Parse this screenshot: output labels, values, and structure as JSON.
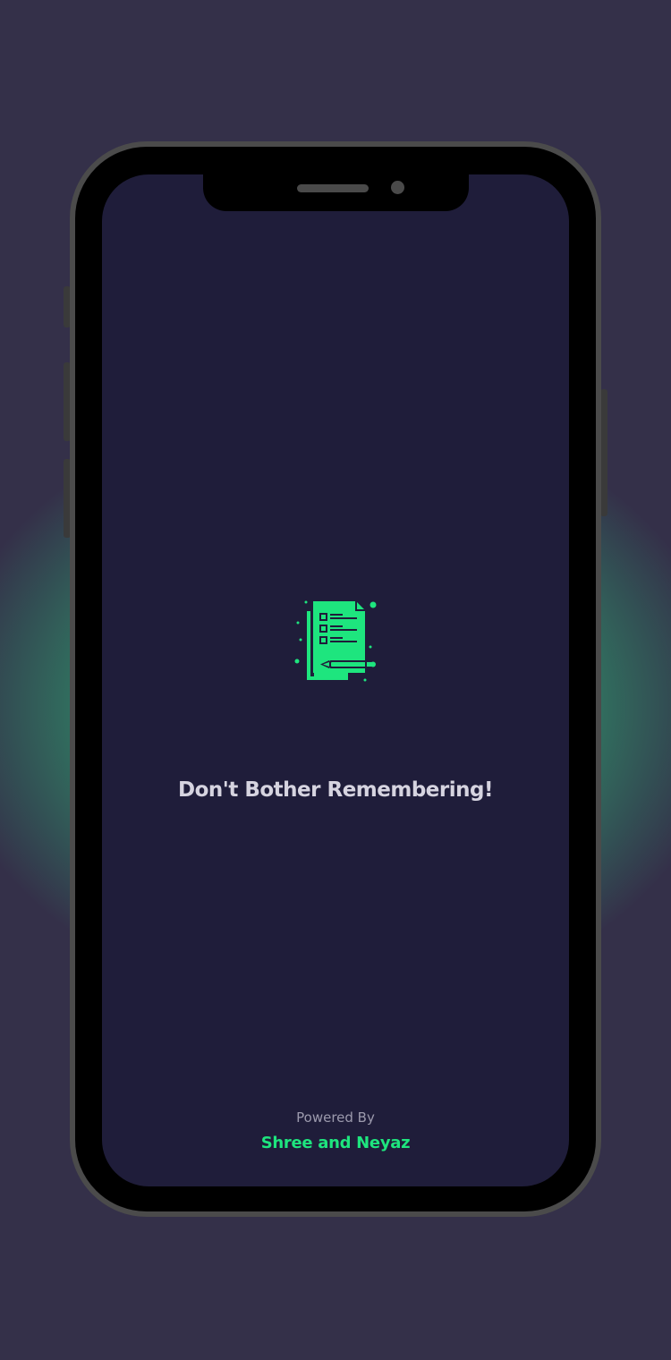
{
  "splash": {
    "tagline": "Don't Bother Remembering!",
    "powered_by_label": "Powered By",
    "authors": "Shree and Neyaz",
    "logo_icon": "checklist-notepad-pencil-icon"
  },
  "colors": {
    "background": "#343049",
    "glow": "#2cd282",
    "screen": "#1f1d3a",
    "accent": "#1ee57e",
    "tagline_text": "#d6d4e0",
    "muted_text": "#9c9aad"
  }
}
